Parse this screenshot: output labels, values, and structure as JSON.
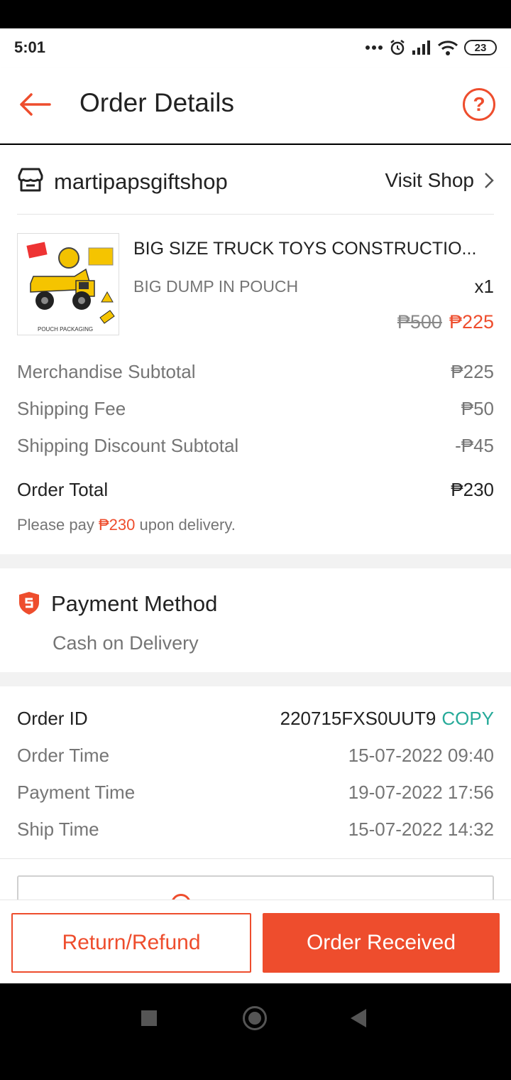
{
  "status_bar": {
    "time": "5:01",
    "battery": "23"
  },
  "header": {
    "title": "Order Details",
    "help_label": "?"
  },
  "shop": {
    "name": "martipapsgiftshop",
    "visit_label": "Visit Shop"
  },
  "product": {
    "name": "BIG SIZE TRUCK TOYS CONSTRUCTIO...",
    "variant": "BIG DUMP IN POUCH",
    "quantity": "x1",
    "original_price": "₱500",
    "price": "₱225",
    "image_caption": "POUCH PACKAGING"
  },
  "summary": {
    "merch_label": "Merchandise Subtotal",
    "merch_value": "₱225",
    "ship_label": "Shipping Fee",
    "ship_value": "₱50",
    "discount_label": "Shipping Discount Subtotal",
    "discount_value": "-₱45",
    "total_label": "Order Total",
    "total_value": "₱230",
    "note_prefix": "Please pay",
    "note_amount": "₱230",
    "note_suffix": "upon delivery."
  },
  "payment": {
    "title": "Payment Method",
    "value": "Cash on Delivery"
  },
  "order_info": {
    "id_label": "Order ID",
    "id_value": "220715FXS0UUT9",
    "copy_label": "COPY",
    "order_time_label": "Order Time",
    "order_time_value": "15-07-2022 09:40",
    "payment_time_label": "Payment Time",
    "payment_time_value": "19-07-2022 17:56",
    "ship_time_label": "Ship Time",
    "ship_time_value": "15-07-2022 14:32"
  },
  "actions": {
    "refund_label": "Return/Refund",
    "received_label": "Order Received"
  },
  "colors": {
    "accent": "#ee4d2d",
    "copy": "#26aa99",
    "muted": "#757575"
  }
}
